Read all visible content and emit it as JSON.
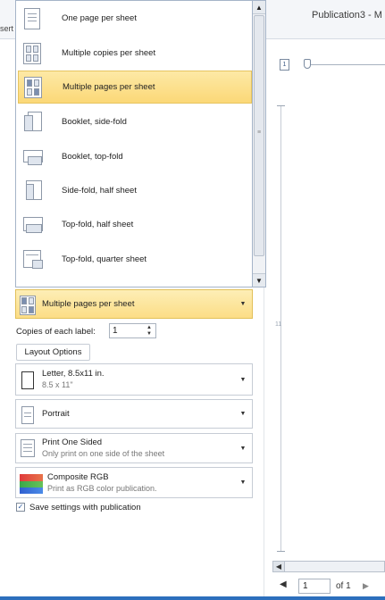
{
  "window": {
    "title": "Publication3 - M",
    "ribbon_tab_partial": "sert"
  },
  "pages_dropdown": {
    "items": [
      {
        "label": "One page per sheet",
        "icon": "one-page-per-sheet-icon"
      },
      {
        "label": "Multiple copies per sheet",
        "icon": "multiple-copies-icon"
      },
      {
        "label": "Multiple pages per sheet",
        "icon": "multiple-pages-icon",
        "selected": true
      },
      {
        "label": "Booklet, side-fold",
        "icon": "booklet-side-fold-icon"
      },
      {
        "label": "Booklet, top-fold",
        "icon": "booklet-top-fold-icon"
      },
      {
        "label": "Side-fold, half sheet",
        "icon": "side-fold-half-icon"
      },
      {
        "label": "Top-fold, half sheet",
        "icon": "top-fold-half-icon"
      },
      {
        "label": "Top-fold, quarter sheet",
        "icon": "top-fold-quarter-icon"
      }
    ],
    "scroll_up_glyph": "▲",
    "scroll_down_glyph": "▼",
    "grip_glyph": "≡"
  },
  "settings": {
    "pages_combo": {
      "label": "Multiple pages per sheet"
    },
    "copies_label": "Copies of each label:",
    "copies_value": "1",
    "layout_options_button": "Layout Options",
    "paper": {
      "title": "Letter, 8.5x11 in.",
      "subtitle": "8.5 x 11\""
    },
    "orientation": {
      "title": "Portrait"
    },
    "sides": {
      "title": "Print One Sided",
      "subtitle": "Only print on one side of the sheet"
    },
    "color": {
      "title": "Composite RGB",
      "subtitle": "Print as RGB color publication."
    },
    "save_settings_label": "Save settings with publication",
    "save_settings_checked": true,
    "caret_glyph": "▼",
    "check_glyph": "✓"
  },
  "preview": {
    "page_icon_label": "1",
    "ruler_mark": "11",
    "page_nav": {
      "current": "1",
      "of_label": "of 1",
      "prev_glyph": "◀",
      "next_glyph": "▶"
    },
    "scroll_left_glyph": "◀"
  },
  "colors": {
    "selected_start": "#fde9a6",
    "selected_end": "#fbd877",
    "selected_border": "#e6c45f",
    "status_bar": "#2c6fbd"
  }
}
